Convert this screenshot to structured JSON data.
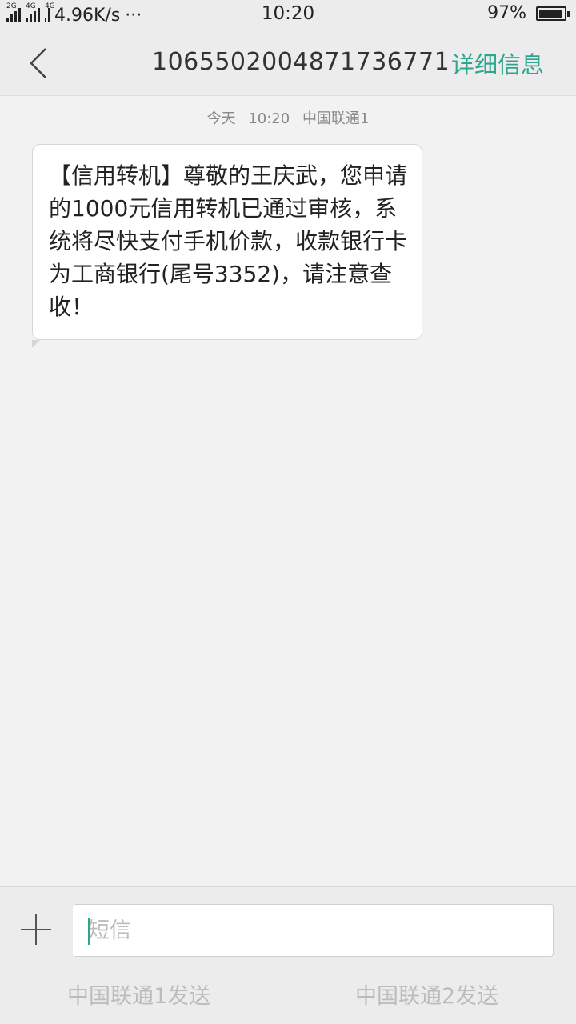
{
  "status_bar": {
    "net_2g": "2G",
    "net_4g": "4G",
    "net_4g_b": "4G",
    "speed": "4.96K/s",
    "more": "···",
    "time": "10:20",
    "battery_text": "97%",
    "battery_level": 0.97
  },
  "header": {
    "back_icon": "chevron-left-icon",
    "title": "1065502004871736771",
    "detail_label": "详细信息",
    "accent_color": "#2fa58f"
  },
  "conversation": {
    "time_label": {
      "day": "今天",
      "time": "10:20",
      "carrier": "中国联通1"
    },
    "messages": [
      {
        "direction": "incoming",
        "text": "【信用转机】尊敬的王庆武，您申请的1000元信用转机已通过审核，系统将尽快支付手机价款，收款银行卡为工商银行(尾号3352)，请注意查收！"
      }
    ]
  },
  "composer": {
    "add_icon": "plus-icon",
    "placeholder": "短信",
    "value": "",
    "send_sim1_label": "中国联通1发送",
    "send_sim2_label": "中国联通2发送"
  }
}
